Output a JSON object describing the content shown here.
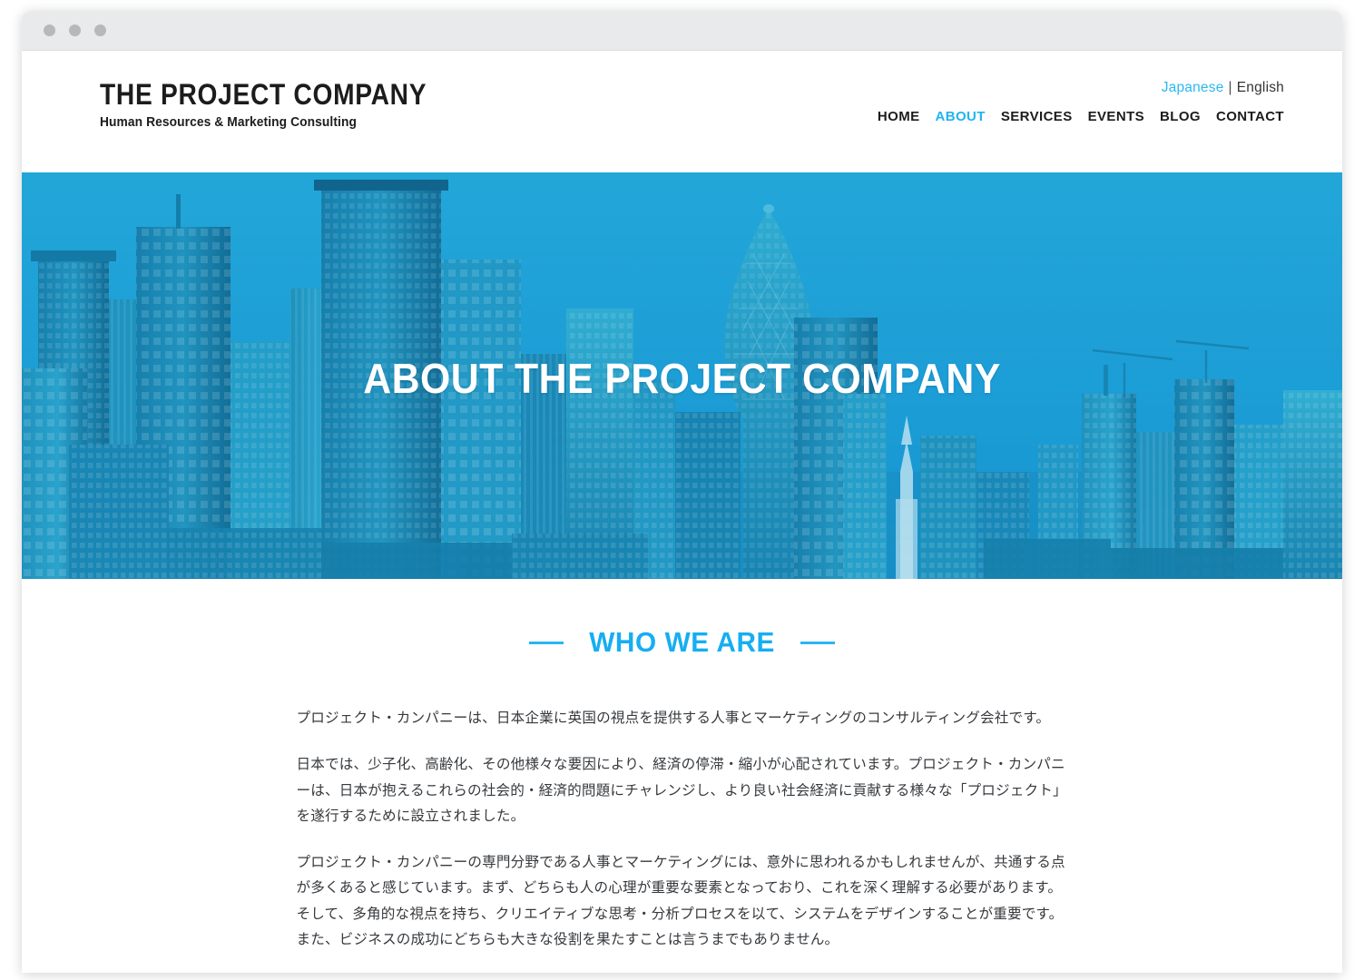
{
  "browser": {
    "traffic_lights": [
      "close",
      "minimize",
      "maximize"
    ]
  },
  "header": {
    "brand_name": "THE PROJECT COMPANY",
    "brand_tagline": "Human Resources & Marketing Consulting",
    "language": {
      "active": "Japanese",
      "separator": "|",
      "other": "English"
    },
    "nav": [
      {
        "label": "HOME",
        "active": false
      },
      {
        "label": "ABOUT",
        "active": true
      },
      {
        "label": "SERVICES",
        "active": false
      },
      {
        "label": "EVENTS",
        "active": false
      },
      {
        "label": "BLOG",
        "active": false
      },
      {
        "label": "CONTACT",
        "active": false
      }
    ]
  },
  "hero": {
    "title": "ABOUT THE PROJECT COMPANY",
    "image_alt": "london-skyline-duotone",
    "tint_color": "#1ca6d6"
  },
  "who_we_are": {
    "heading": "WHO WE ARE",
    "heading_color": "#16aef2",
    "paragraphs": [
      "プロジェクト・カンパニーは、日本企業に英国の視点を提供する人事とマーケティングのコンサルティング会社です。",
      "日本では、少子化、高齢化、その他様々な要因により、経済の停滞・縮小が心配されています。プロジェクト・カンパニーは、日本が抱えるこれらの社会的・経済的問題にチャレンジし、より良い社会経済に貢献する様々な「プロジェクト」を遂行するために設立されました。",
      "プロジェクト・カンパニーの専門分野である人事とマーケティングには、意外に思われるかもしれませんが、共通する点が多くあると感じています。まず、どちらも人の心理が重要な要素となっており、これを深く理解する必要があります。そして、多角的な視点を持ち、クリエイティブな思考・分析プロセスを以て、システムをデザインすることが重要です。また、ビジネスの成功にどちらも大きな役割を果たすことは言うまでもありません。"
    ]
  }
}
